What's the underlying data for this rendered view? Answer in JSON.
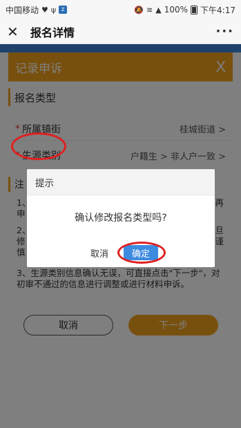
{
  "status_bar": {
    "carrier": "中国移动",
    "percent": "100%",
    "time": "下午4:17"
  },
  "title_bar": {
    "title": "报名详情",
    "more": "···"
  },
  "panel": {
    "header": "记录申诉",
    "close": "X",
    "section": "报名类型",
    "rows": [
      {
        "label": "所属镇街",
        "value": "桂城街道 >"
      },
      {
        "label": "生源类别",
        "value": "户籍生 >   非人户一致 >"
      }
    ],
    "notes_title": "注",
    "notes": [
      "1、",
      "再",
      "申",
      "2、",
      "一旦",
      "修",
      "请谨",
      "慎",
      "3、生源类别信息确认无误，可直接点击\"下一步\"，对初审不通过的信息进行调整或进行材料申诉。"
    ],
    "cancel": "取消",
    "next": "下一步"
  },
  "dialog": {
    "title": "提示",
    "message": "确认修改报名类型吗?",
    "cancel": "取消",
    "ok": "确定"
  },
  "colors": {
    "accent": "#f0a01d",
    "primary": "#3d8be0",
    "annotation": "#e02020"
  }
}
